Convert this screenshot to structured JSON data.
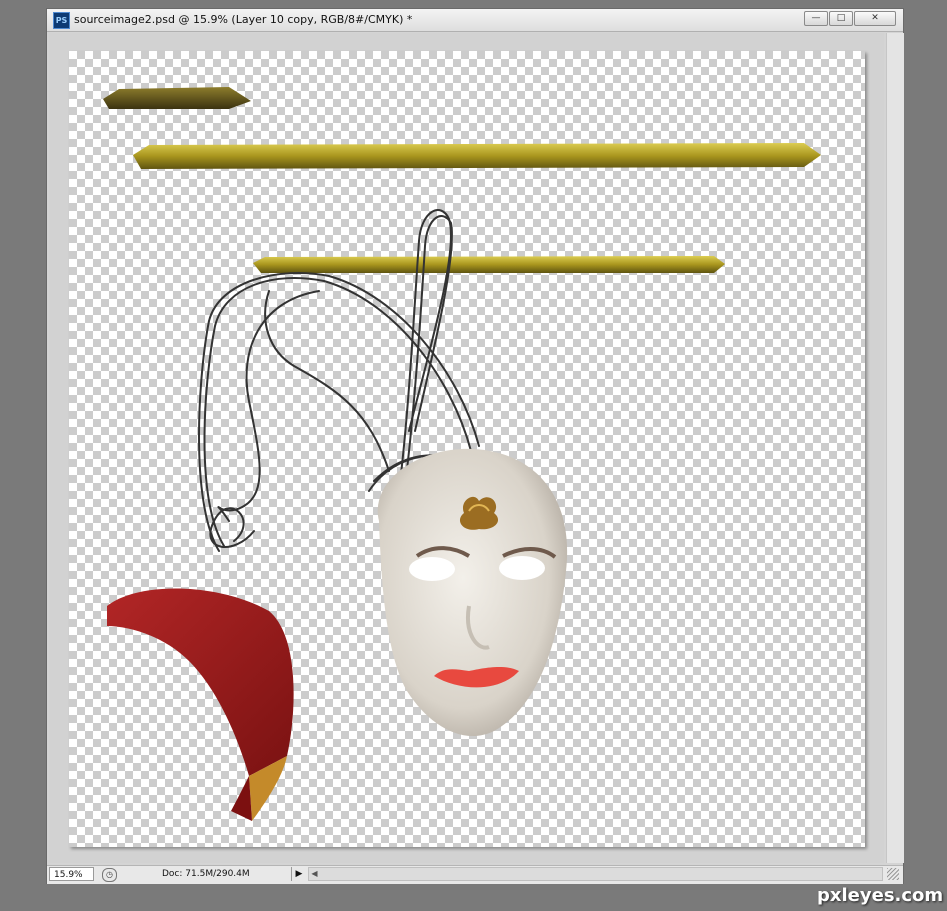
{
  "window": {
    "app_icon": "PS",
    "title": "sourceimage2.psd @ 15.9% (Layer 10 copy, RGB/8#/CMYK) *",
    "controls": {
      "minimize": "—",
      "maximize": "□",
      "close": "✕"
    }
  },
  "status": {
    "zoom": "15.9%",
    "doc_info": "Doc: 71.5M/290.4M",
    "menu_arrow": "▶",
    "scroll_left": "◀"
  },
  "watermark": "pxleyes.com",
  "colors": {
    "canvas_bg": "#d2d2d2",
    "checker_dark": "#cccccc",
    "gold": "#b7a326",
    "feather_red": "#9a1d1d",
    "lips": "#e8493f"
  }
}
